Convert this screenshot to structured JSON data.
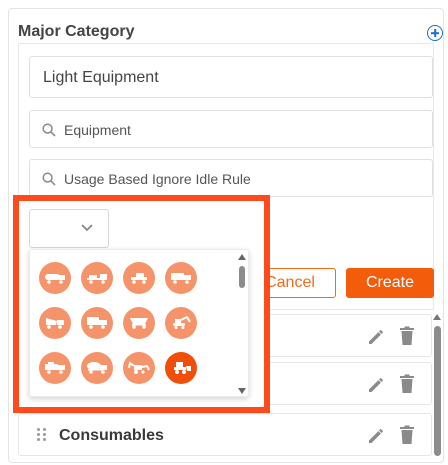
{
  "form": {
    "heading": "Major Category",
    "name_value": "Light Equipment",
    "search_fields": [
      {
        "value": "Equipment"
      },
      {
        "value": "Usage Based Ignore Idle Rule"
      }
    ],
    "cancel_label": "Cancel",
    "create_label": "Create"
  },
  "icon_picker": {
    "icons": [
      {
        "icon": "truck-tanker-icon"
      },
      {
        "icon": "truck-flatbed-icon"
      },
      {
        "icon": "truck-tractor-icon"
      },
      {
        "icon": "truck-box-icon"
      },
      {
        "icon": "truck-dump-icon"
      },
      {
        "icon": "truck-cargo-icon"
      },
      {
        "icon": "truck-hopper-icon"
      },
      {
        "icon": "excavator-icon"
      },
      {
        "icon": "truck-service-icon"
      },
      {
        "icon": "truck-mixer-icon"
      },
      {
        "icon": "backhoe-icon"
      },
      {
        "icon": "loader-icon",
        "selected": true
      }
    ]
  },
  "list": {
    "rows": [
      {
        "label": ""
      },
      {
        "label": ""
      },
      {
        "label": "Consumables"
      }
    ]
  },
  "colors": {
    "accent": "#f25c0a",
    "highlight_border": "#ff4a1c",
    "icon_fill": "#f5946a",
    "icon_selected": "#f04e09",
    "add_icon": "#1a6fc9"
  }
}
